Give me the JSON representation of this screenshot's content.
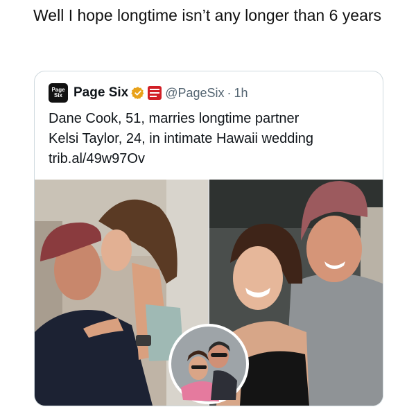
{
  "post": {
    "caption": "Well I hope longtime isn’t any longer than 6 years"
  },
  "quoted_tweet": {
    "avatar_label_line1": "Page",
    "avatar_label_line2": "Six",
    "display_name": "Page Six",
    "verified_icon": "verified-badge-icon",
    "publisher_logo_icon": "new-york-post-logo",
    "handle": "@PageSix",
    "separator": "·",
    "time_ago": "1h",
    "text_line1": "Dane Cook, 51, marries longtime partner",
    "text_line2": "Kelsi Taylor, 24, in intimate Hawaii wedding",
    "link": "trib.al/49w97Ov",
    "verified_color": "#e8a21b",
    "publisher_color": "#d11f26"
  },
  "media": {
    "left_photo": "couple-kissing-photo",
    "right_photo": "couple-selfie-photo",
    "inset_photo": "couple-inset-photo"
  }
}
